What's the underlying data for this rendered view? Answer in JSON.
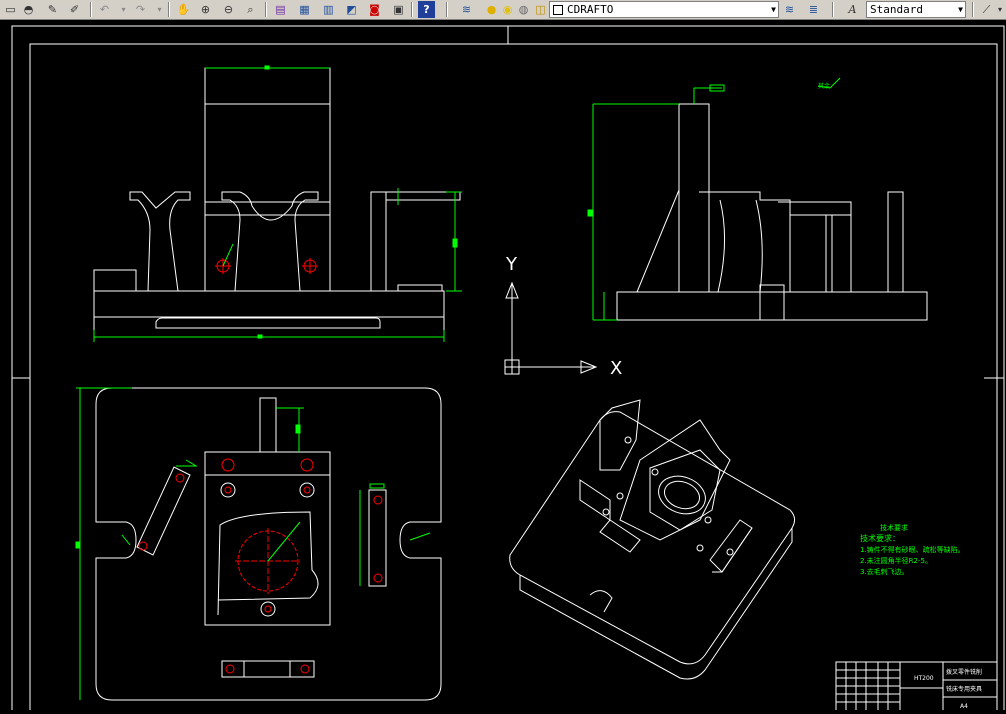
{
  "toolbar": {
    "layer_name": "CDRAFTO",
    "text_style": "Standard",
    "icons": [
      "new-icon",
      "open-icon",
      "pencil-icon",
      "match-props-icon",
      "undo-icon",
      "redo-icon",
      "pan-icon",
      "zoom-realtime-icon",
      "zoom-window-icon",
      "zoom-previous-icon",
      "properties-icon",
      "design-center-icon",
      "tool-palettes-icon",
      "sheet-set-icon",
      "markup-icon",
      "calculator-icon",
      "help-icon",
      "layer-manager-icon",
      "layer-on-icon",
      "layer-freeze-icon",
      "layer-lock-icon",
      "layer-color-icon",
      "text-style-icon",
      "dim-style-icon"
    ]
  },
  "drawing": {
    "axis_y_label": "Y",
    "axis_x_label": "X",
    "tech_title": "技术要求",
    "tech_header": "技术要求：",
    "tech_lines": [
      "1.铸件不得有砂眼、疏松等缺陷。",
      "2.未注圆角半径R2-5。",
      "3.去毛刺飞边。"
    ],
    "annotation_mark": "其余",
    "title_block": {
      "material": "HT200",
      "name_line1": "拨叉零件铣削",
      "name_line2": "铣床专用夹具",
      "sheet": "A4"
    }
  },
  "colors": {
    "lines": "#ffffff",
    "dimensions": "#00ff00",
    "centerlines": "#ff0000",
    "background": "#000000",
    "toolbar": "#d4d0c8"
  }
}
